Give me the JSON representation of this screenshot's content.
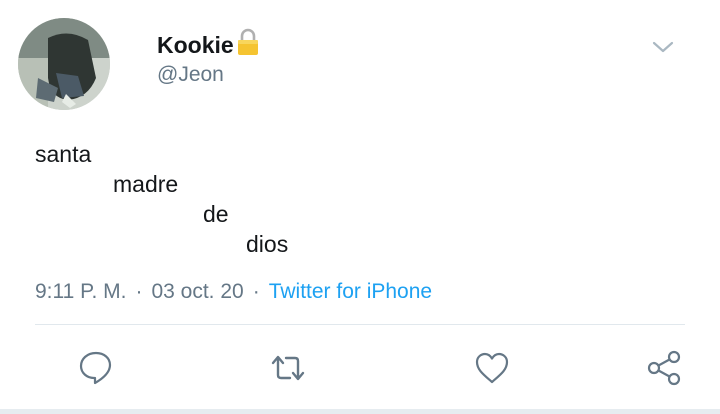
{
  "user": {
    "name": "Kookie",
    "handle": "@Jeon"
  },
  "tweet": {
    "lines": [
      "santa",
      "madre",
      "de",
      "dios"
    ]
  },
  "meta": {
    "time": "9:11 P. M.",
    "separator": "·",
    "date": "03 oct. 20",
    "source": "Twitter for iPhone"
  },
  "icons": {
    "avatar": "user-photo",
    "lock": "lock-icon",
    "menu": "chevron-down-icon",
    "reply": "reply-icon",
    "retweet": "retweet-icon",
    "like": "heart-icon",
    "share": "share-icon"
  },
  "colors": {
    "accent": "#1da1f2",
    "secondary_text": "#657786",
    "icon": "#657786"
  }
}
